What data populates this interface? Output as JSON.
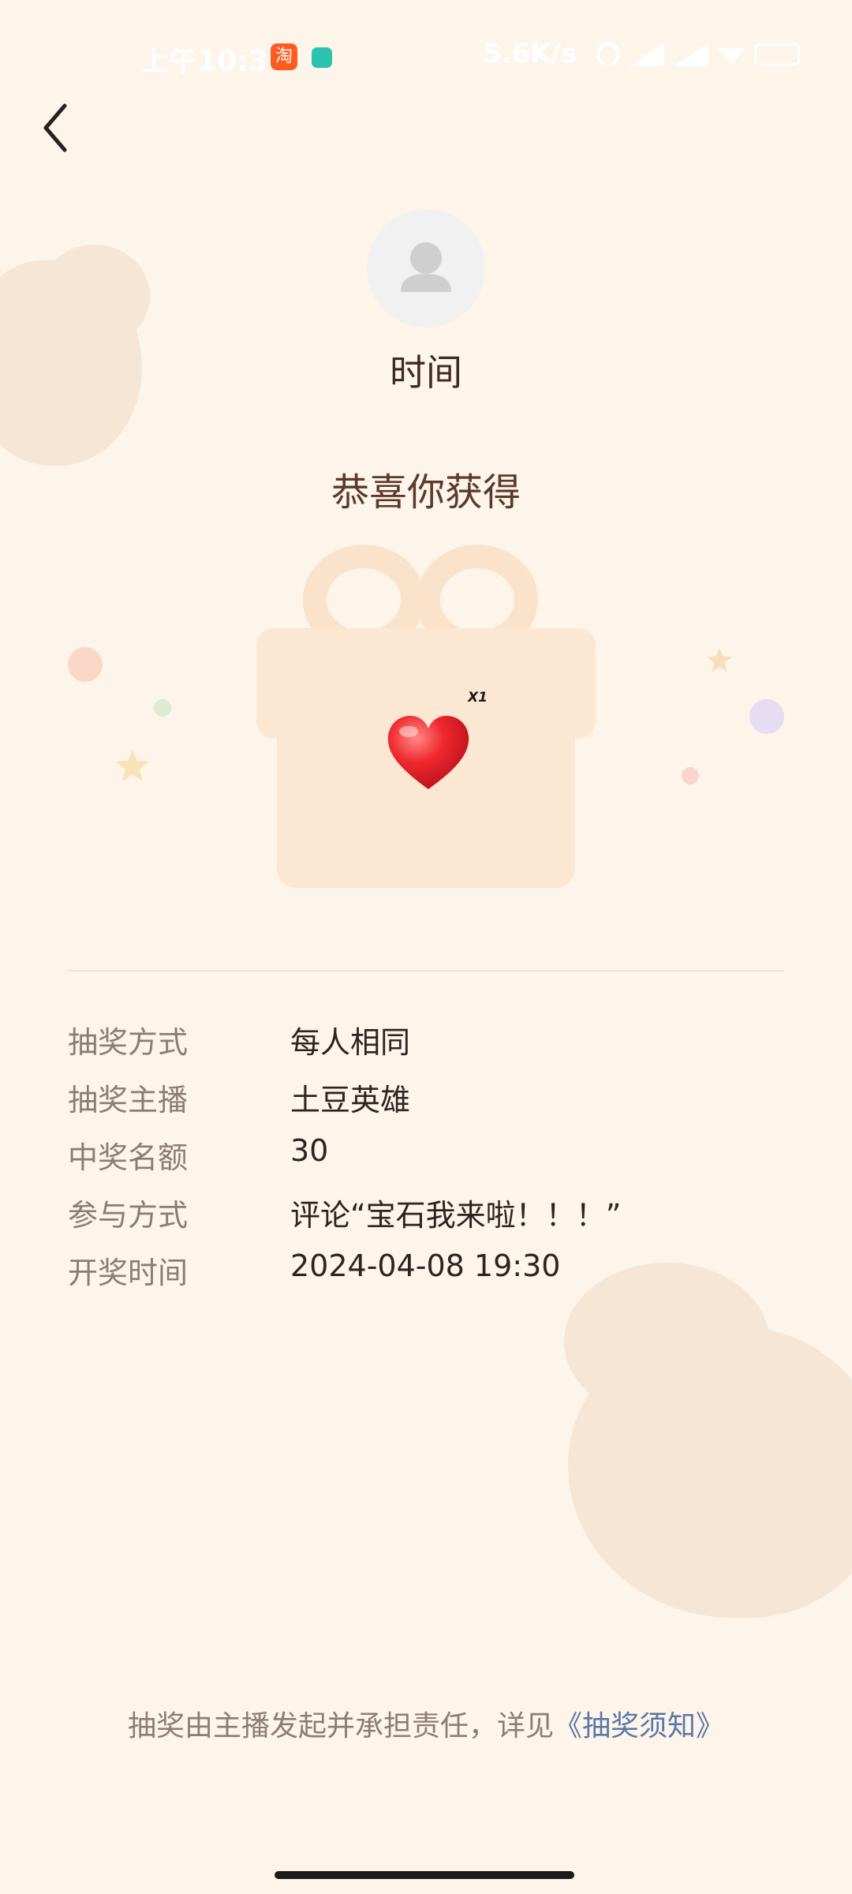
{
  "status_bar": {
    "time": "上午10:30",
    "app_icon_1_text": "淘",
    "network_speed": "5.6K/s",
    "icons": [
      "alarm-icon",
      "signal-hd-icon",
      "signal-icon",
      "wifi-icon",
      "battery-icon"
    ]
  },
  "header": {
    "back_icon": "chevron-left-icon"
  },
  "winner": {
    "username": "时间",
    "avatar_icon": "person-icon"
  },
  "prize": {
    "congrats_text": "恭喜你获得",
    "item_icon": "heart-icon",
    "quantity": "X1"
  },
  "details": [
    {
      "label": "抽奖方式",
      "value": "每人相同"
    },
    {
      "label": "抽奖主播",
      "value": "土豆英雄"
    },
    {
      "label": "中奖名额",
      "value": "30"
    },
    {
      "label": "参与方式",
      "value": "评论“宝石我来啦！！！”"
    },
    {
      "label": "开奖时间",
      "value": "2024-04-08 19:30"
    }
  ],
  "footer": {
    "text": "抽奖由主播发起并承担责任，详见",
    "link": "《抽奖须知》"
  },
  "colors": {
    "background": "#FDF4EA",
    "link": "#5A78A8",
    "heart": "#E8202A"
  }
}
